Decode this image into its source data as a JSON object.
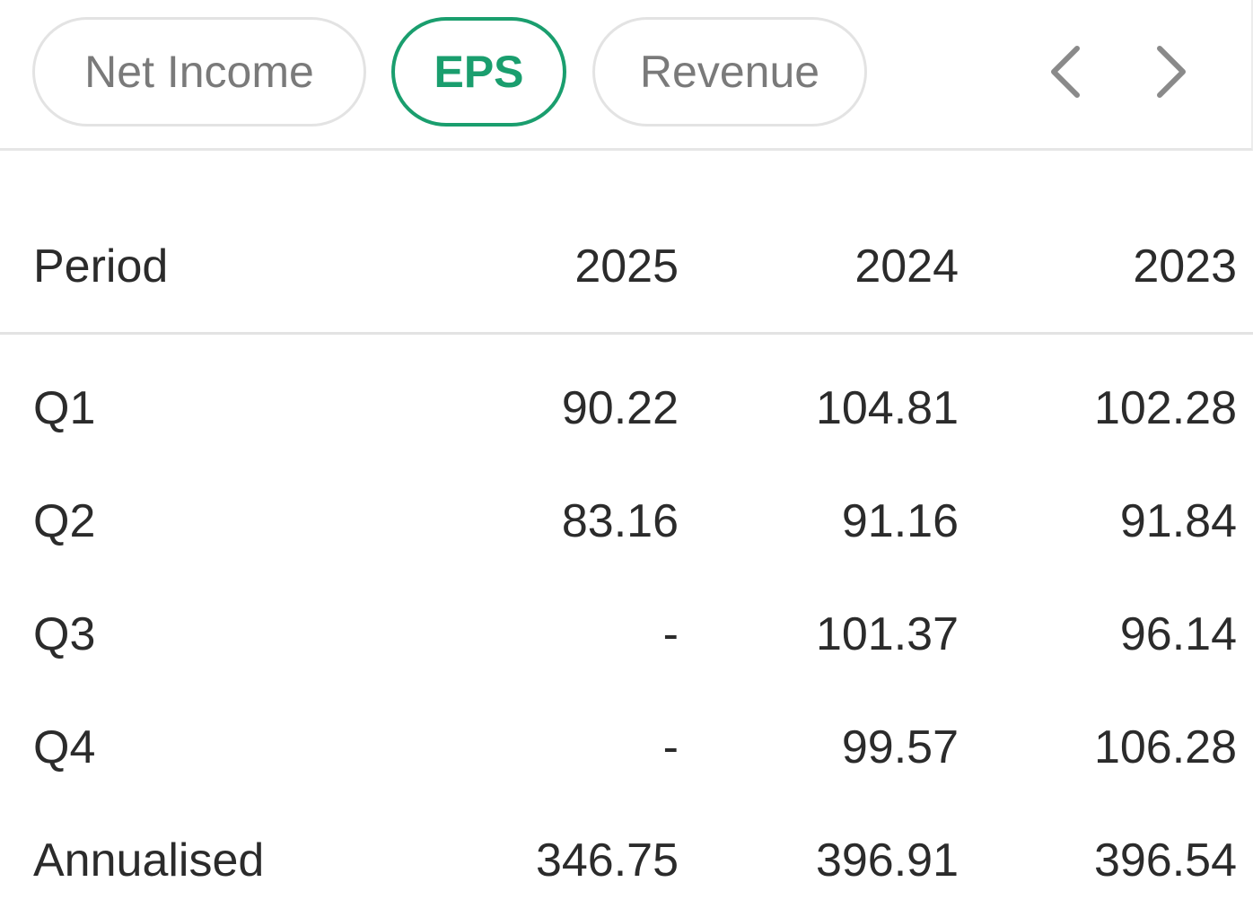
{
  "tabs": [
    {
      "label": "Net Income",
      "active": false
    },
    {
      "label": "EPS",
      "active": true
    },
    {
      "label": "Revenue",
      "active": false
    }
  ],
  "nav": {
    "prev_icon": "chevron-left-icon",
    "next_icon": "chevron-right-icon"
  },
  "colors": {
    "accent": "#1a9e6e",
    "text": "#2b2b2b",
    "tab_text": "#7a7a7a",
    "border": "#e3e3e3"
  },
  "table": {
    "header": {
      "label": "Period",
      "years": [
        "2025",
        "2024",
        "2023"
      ]
    },
    "rows": [
      {
        "label": "Q1",
        "values": [
          "90.22",
          "104.81",
          "102.28"
        ]
      },
      {
        "label": "Q2",
        "values": [
          "83.16",
          "91.16",
          "91.84"
        ]
      },
      {
        "label": "Q3",
        "values": [
          "-",
          "101.37",
          "96.14"
        ]
      },
      {
        "label": "Q4",
        "values": [
          "-",
          "99.57",
          "106.28"
        ]
      },
      {
        "label": "Annualised",
        "values": [
          "346.75",
          "396.91",
          "396.54"
        ]
      }
    ]
  }
}
